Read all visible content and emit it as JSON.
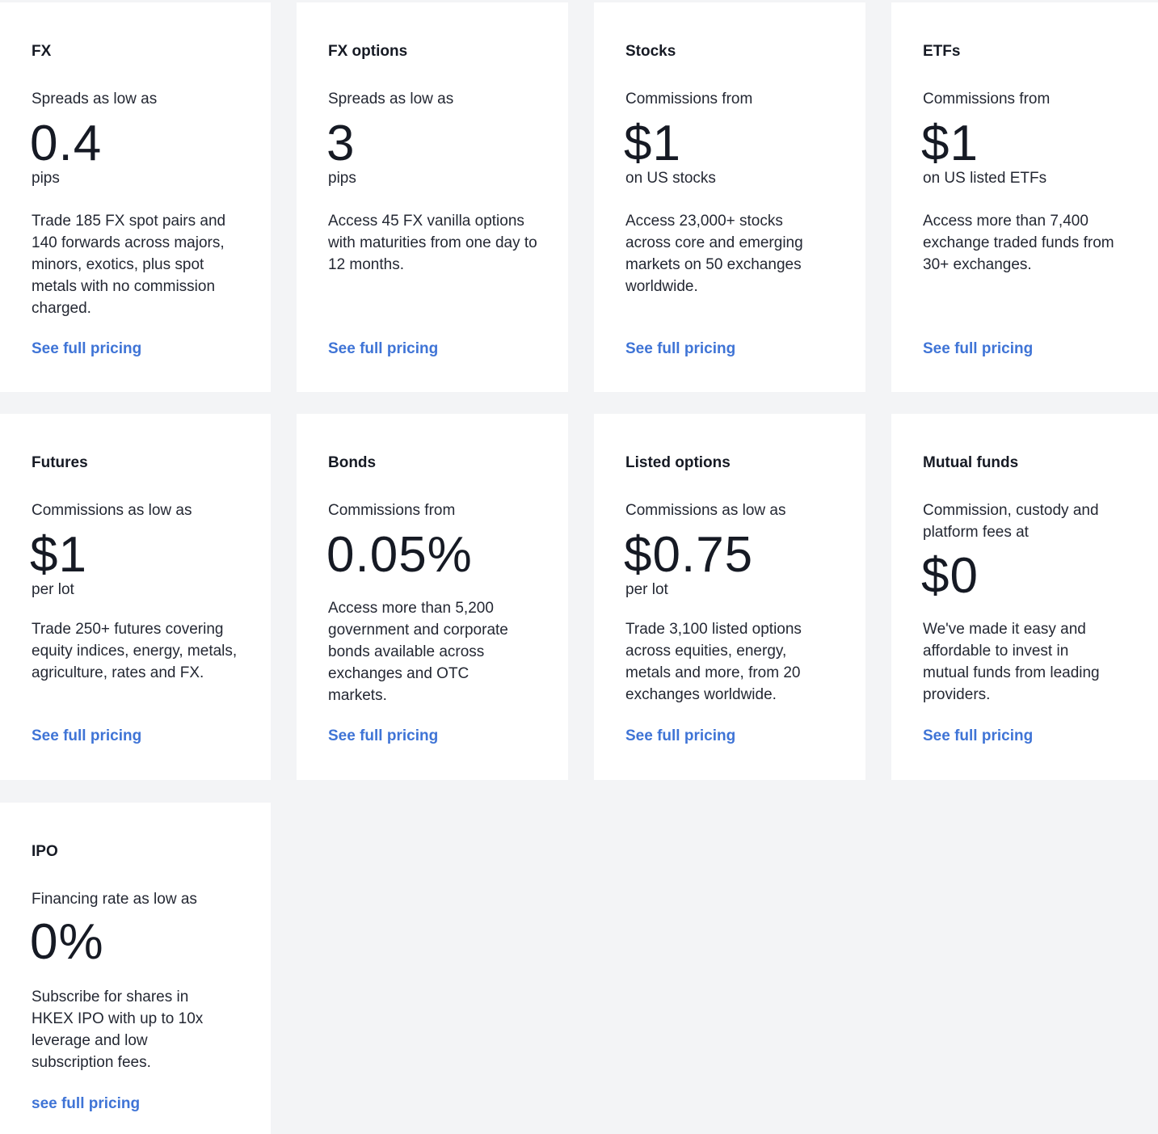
{
  "cards": [
    {
      "title": "FX",
      "label": "Spreads as low as",
      "value": "0.4",
      "unit": "pips",
      "description": "Trade 185 FX spot pairs and 140 forwards across majors, minors, exotics, plus spot metals with no commission charged.",
      "link": "See full pricing"
    },
    {
      "title": "FX options",
      "label": "Spreads as low as",
      "value": "3",
      "unit": "pips",
      "description": "Access 45 FX vanilla options with maturities from one day to 12 months.",
      "link": "See full pricing"
    },
    {
      "title": "Stocks",
      "label": "Commissions from",
      "value": "$1",
      "unit": "on US stocks",
      "description": "Access 23,000+ stocks across core and emerging markets on 50 exchanges worldwide.",
      "link": "See full pricing"
    },
    {
      "title": "ETFs",
      "label": "Commissions from",
      "value": "$1",
      "unit": "on US listed ETFs",
      "description": "Access more than 7,400 exchange traded funds from 30+ exchanges.",
      "link": "See full pricing"
    },
    {
      "title": "Futures",
      "label": "Commissions as low as",
      "value": "$1",
      "unit": "per lot",
      "description": "Trade 250+ futures covering equity indices, energy, metals, agriculture, rates and FX.",
      "link": "See full pricing"
    },
    {
      "title": "Bonds",
      "label": "Commissions from",
      "value": "0.05%",
      "unit": "",
      "description": "Access more than 5,200 government and corporate bonds available across exchanges and OTC markets.",
      "link": "See full pricing"
    },
    {
      "title": "Listed options",
      "label": "Commissions as low as",
      "value": "$0.75",
      "unit": "per lot",
      "description": "Trade 3,100 listed options across equities, energy, metals and more, from 20 exchanges worldwide.",
      "link": "See full pricing"
    },
    {
      "title": "Mutual funds",
      "label": "Commission, custody and platform fees at",
      "value": "$0",
      "unit": "",
      "description": "We've made it easy and affordable to invest in mutual funds from leading providers.",
      "link": "See full pricing"
    },
    {
      "title": "IPO",
      "label": "Financing rate as low as",
      "value": "0%",
      "unit": "",
      "description": "Subscribe for shares in HKEX IPO with up to 10x leverage and low subscription fees.",
      "link": "see full pricing"
    }
  ],
  "colors": {
    "page_background": "#f3f4f6",
    "card_background": "#ffffff",
    "text_dark": "#161a24",
    "link_blue": "#3f74d6"
  }
}
